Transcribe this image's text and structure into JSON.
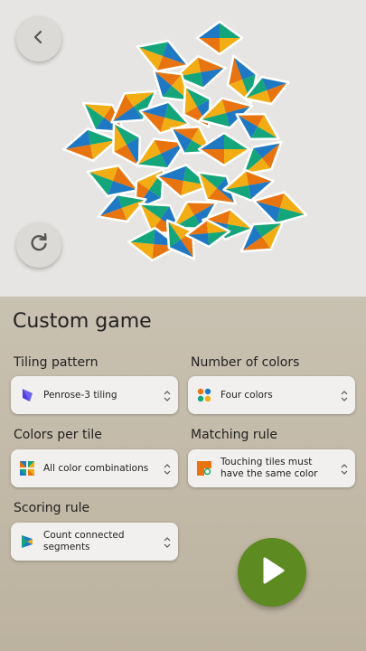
{
  "screen": {
    "title": "Custom game"
  },
  "controls": {
    "back_icon": "chevron-left-icon",
    "refresh_icon": "refresh-icon",
    "play_icon": "play-icon"
  },
  "settings": {
    "tiling": {
      "label": "Tiling pattern",
      "value": "Penrose-3 tiling",
      "icon": "penrose-rhomb-icon"
    },
    "colors": {
      "label": "Number of colors",
      "value": "Four colors",
      "icon": "four-dots-icon"
    },
    "per_tile": {
      "label": "Colors per tile",
      "value": "All color combinations",
      "icon": "color-combinations-icon"
    },
    "matching": {
      "label": "Matching rule",
      "value": "Touching tiles must have the same color",
      "icon": "matching-tile-icon"
    },
    "scoring": {
      "label": "Scoring rule",
      "value": "Count connected segments",
      "icon": "segment-icon"
    }
  },
  "palette": {
    "blue": "#1f78c4",
    "orange": "#e8740f",
    "yellow": "#f2ad14",
    "green": "#14a67a",
    "play_green": "#5e8a22",
    "board_bg": "#e6e5e3",
    "panel_bg": "#c3baa8"
  }
}
